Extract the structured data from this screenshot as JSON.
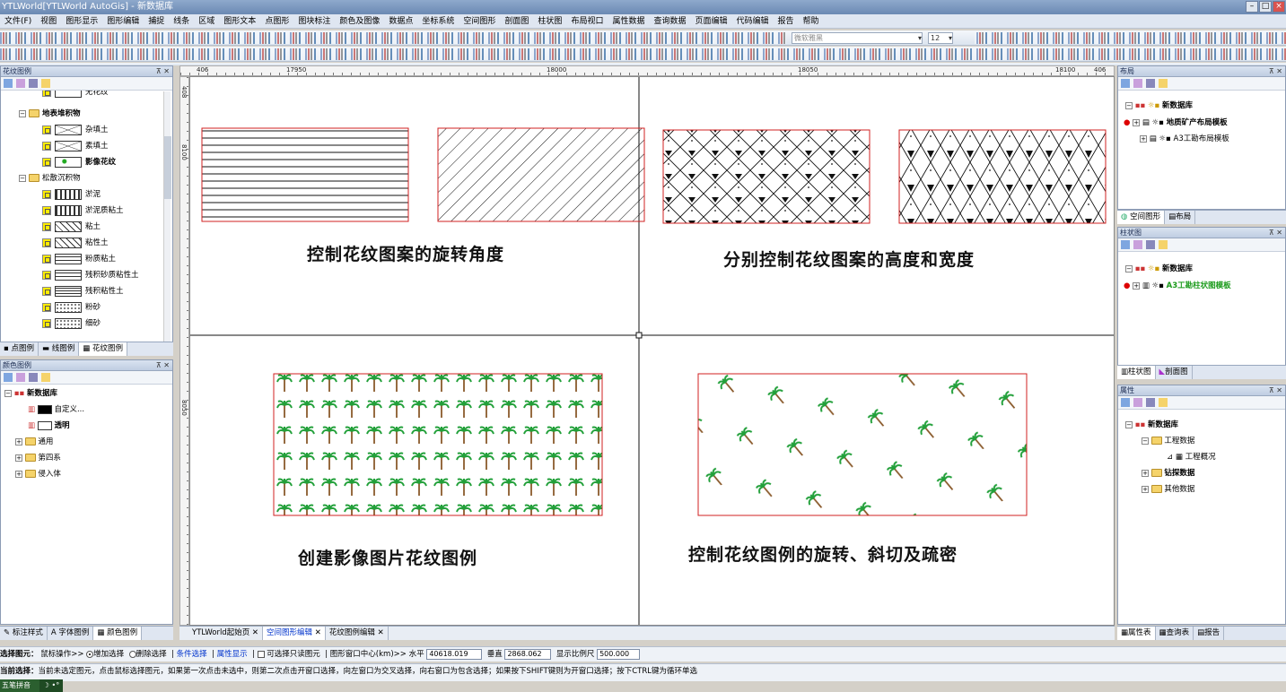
{
  "window": {
    "title": "YTLWorld[YTLWorld AutoGis] - 新数据库"
  },
  "menu": [
    "文件(F)",
    "视图",
    "图形显示",
    "图形编辑",
    "捕捉",
    "线条",
    "区域",
    "图形文本",
    "点图形",
    "图块标注",
    "颜色及图像",
    "数据点",
    "坐标系统",
    "空间图形",
    "剖面图",
    "柱状图",
    "布局视口",
    "属性数据",
    "查询数据",
    "页面编辑",
    "代码编辑",
    "报告",
    "帮助"
  ],
  "toolbar": {
    "font_name": "微软雅黑",
    "font_size": "12"
  },
  "ruler": {
    "top_labels": [
      "406",
      "17950",
      "18000",
      "18050",
      "18100",
      "406"
    ],
    "left_labels": [
      "408",
      "8100",
      "8050"
    ]
  },
  "left_top_panel": {
    "title": "花纹图例",
    "items": [
      {
        "label": "无花纹",
        "level": 2,
        "bold": false,
        "swatch": "none",
        "partial": true
      },
      {
        "label": "地表堆积物",
        "level": 1,
        "bold": true,
        "group": true
      },
      {
        "label": "杂填土",
        "level": 2,
        "bold": false,
        "swatch": "cross"
      },
      {
        "label": "素填土",
        "level": 2,
        "bold": false,
        "swatch": "cross"
      },
      {
        "label": "影像花纹",
        "level": 2,
        "bold": true,
        "swatch": "palm"
      },
      {
        "label": "松散沉积物",
        "level": 1,
        "bold": false,
        "group": true
      },
      {
        "label": "淤泥",
        "level": 2,
        "bold": false,
        "swatch": "wave"
      },
      {
        "label": "淤泥质粘土",
        "level": 2,
        "bold": false,
        "swatch": "wave"
      },
      {
        "label": "粘土",
        "level": 2,
        "bold": false,
        "swatch": "diag"
      },
      {
        "label": "粘性土",
        "level": 2,
        "bold": false,
        "swatch": "diag"
      },
      {
        "label": "粉质粘土",
        "level": 2,
        "bold": false,
        "swatch": "dash"
      },
      {
        "label": "残积砂质粘性土",
        "level": 2,
        "bold": false,
        "swatch": "dash"
      },
      {
        "label": "残积粘性土",
        "level": 2,
        "bold": false,
        "swatch": "lines"
      },
      {
        "label": "粉砂",
        "level": 2,
        "bold": false,
        "swatch": "dots"
      },
      {
        "label": "细砂",
        "level": 2,
        "bold": false,
        "swatch": "dots"
      }
    ],
    "tabs": [
      "点图例",
      "线图例",
      "花纹图例"
    ]
  },
  "left_bottom_panel": {
    "title": "颜色图例",
    "root": "新数据库",
    "items": [
      {
        "label": "自定义...",
        "bold": false,
        "swatch": "#000000"
      },
      {
        "label": "透明",
        "bold": true,
        "swatch": "#ffffff"
      }
    ],
    "groups": [
      "通用",
      "第四系",
      "侵入体"
    ],
    "tabs": [
      "标注样式",
      "字体图例",
      "颜色图例"
    ]
  },
  "doc_tabs": [
    "YTLWorld起始页",
    "空间图形编辑",
    "花纹图例编辑"
  ],
  "canvas": {
    "captions": [
      "控制花纹图案的旋转角度",
      "分别控制花纹图案的高度和宽度",
      "创建影像图片花纹图例",
      "控制花纹图例的旋转、斜切及疏密"
    ]
  },
  "right_panels": {
    "layout": {
      "title": "布局",
      "root": "新数据库",
      "items": [
        "地质矿产布局模板",
        "A3工勘布局模板"
      ],
      "tabs": [
        "空间图形",
        "布局"
      ]
    },
    "column": {
      "title": "柱状图",
      "root": "新数据库",
      "items": [
        "A3工勘柱状图模板"
      ],
      "tabs": [
        "柱状图",
        "剖面图"
      ]
    },
    "props": {
      "title": "属性",
      "root": "新数据库",
      "items": [
        "工程数据",
        "工程概况",
        "钻探数据",
        "其他数据"
      ],
      "tabs": [
        "属性表",
        "查询表",
        "报告"
      ]
    }
  },
  "status": {
    "select_label": "选择图元：",
    "mouse_op": "鼠标操作>>",
    "add_select": "增加选择",
    "remove_select": "删除选择",
    "cond_select": "条件选择",
    "attr_show": "属性显示",
    "readonly_select": "可选择只读图元",
    "center_label": "图形窗口中心(km)>>",
    "h_label": "水平",
    "h_value": "40618.019",
    "v_label": "垂直",
    "v_value": "2868.062",
    "scale_label": "显示比例尺",
    "scale_value": "500.000",
    "hint_label": "当前选择：",
    "hint": "当前未选定图元，点击鼠标选择图元，如果第一次点击未选中，则第二次点击开窗口选择，向左窗口为交叉选择，向右窗口为包含选择；如果按下SHIFT键则为开窗口选择；按下CTRL键为循环单选",
    "ime": "五笔拼音"
  }
}
